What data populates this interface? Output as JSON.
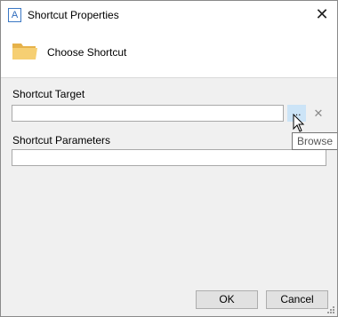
{
  "window": {
    "title": "Shortcut Properties",
    "app_icon_glyph": "A",
    "close_glyph": "✕"
  },
  "header": {
    "title": "Choose Shortcut",
    "icon": "folder-icon"
  },
  "form": {
    "target_label": "Shortcut Target",
    "target_value": "",
    "browse_label": "...",
    "clear_glyph": "✕",
    "browse_tooltip": "Browse",
    "params_label": "Shortcut Parameters",
    "params_value": ""
  },
  "buttons": {
    "ok": "OK",
    "cancel": "Cancel"
  },
  "colors": {
    "browse_hover": "#cce4f7",
    "folder": "#f0c35c"
  }
}
